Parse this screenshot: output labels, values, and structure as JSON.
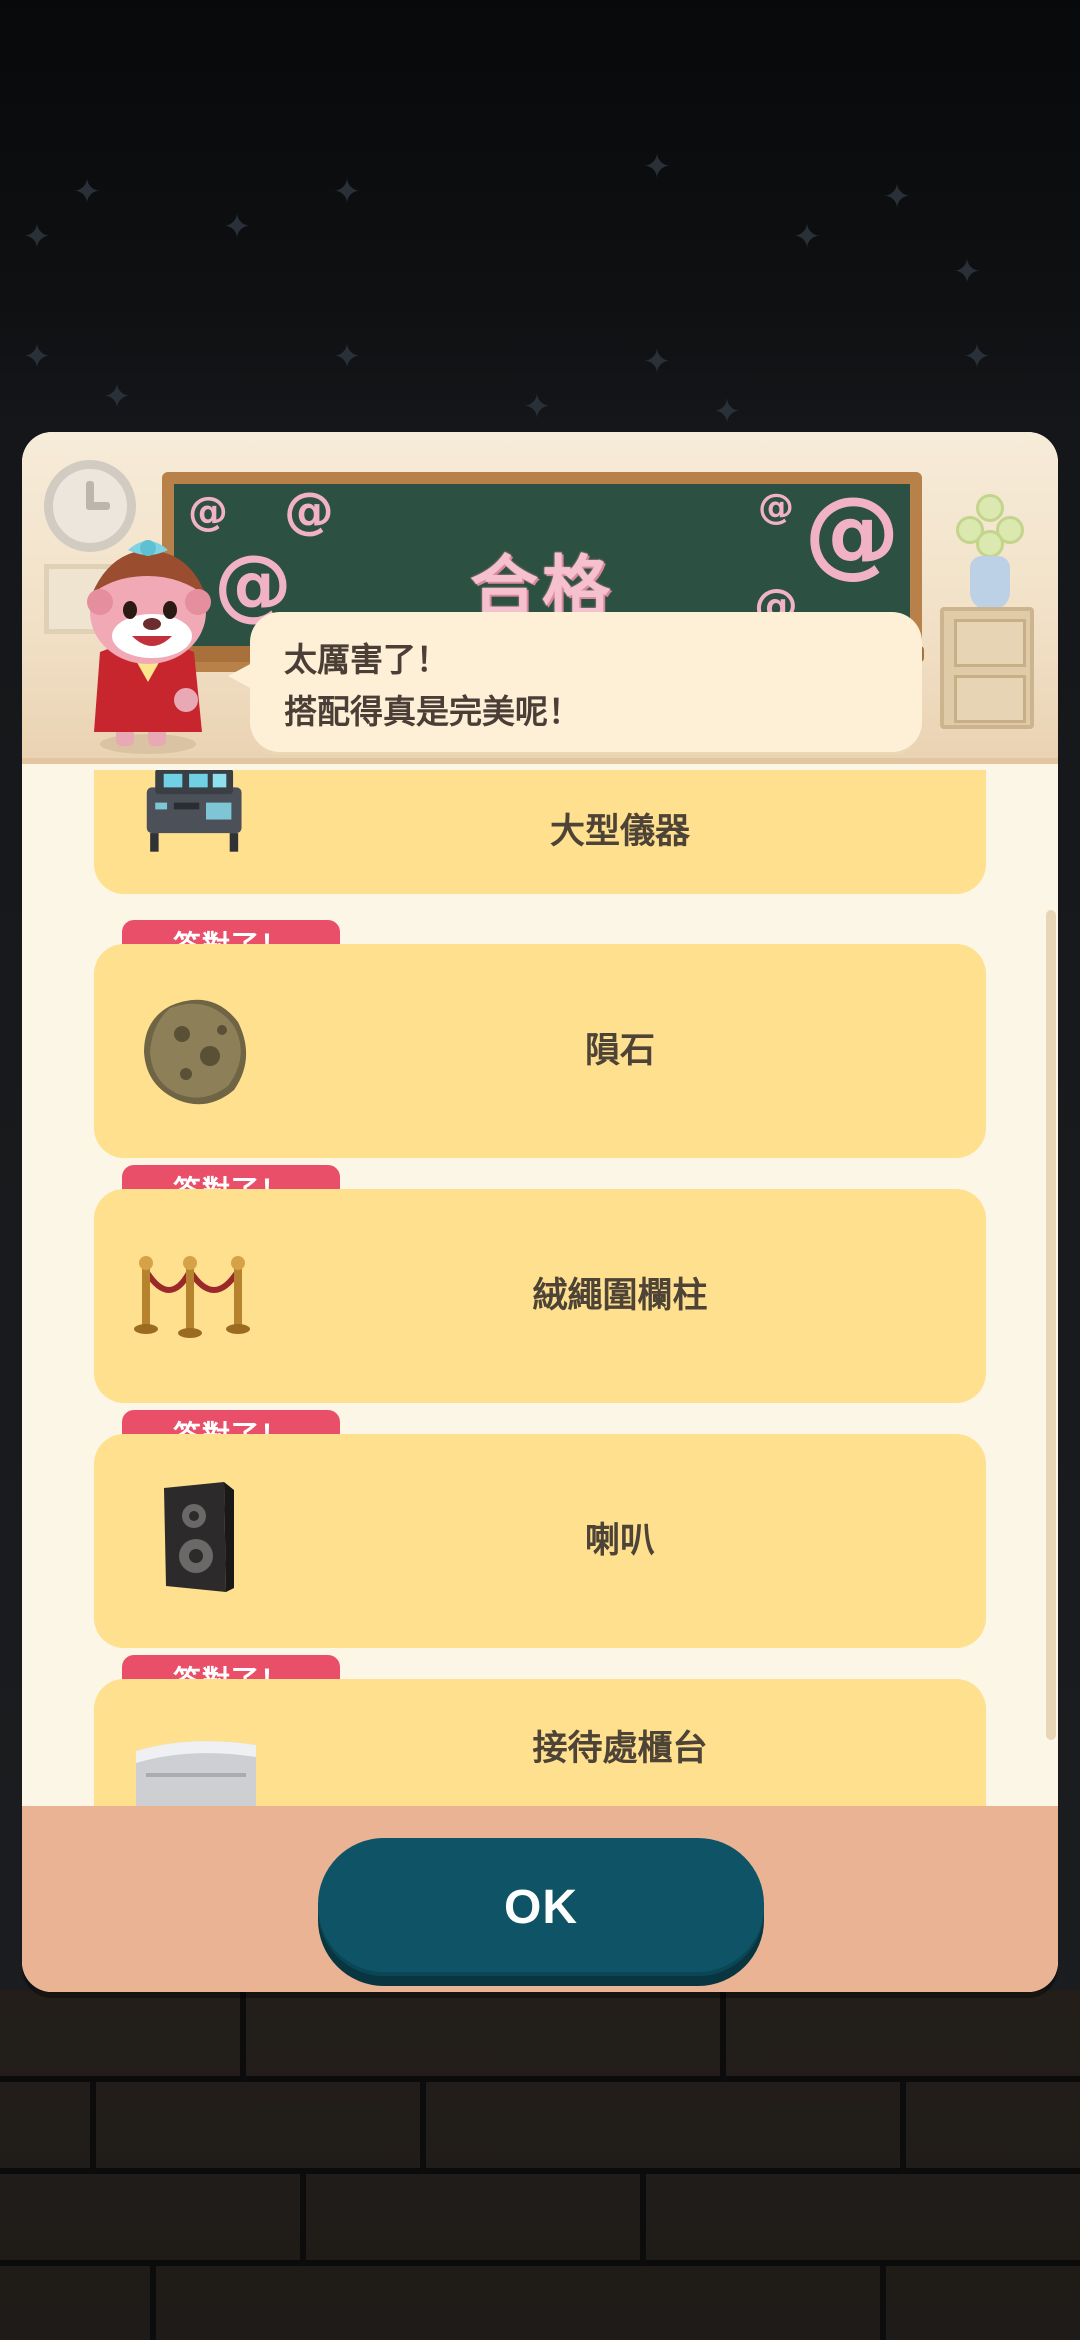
{
  "dialog": {
    "board_title": "合格",
    "speech_line1": "太厲害了！",
    "speech_line2": "搭配得真是完美呢！"
  },
  "items": [
    {
      "name": "大型儀器",
      "icon": "control-panel-icon",
      "badge": ""
    },
    {
      "name": "隕石",
      "icon": "meteorite-icon",
      "badge": "答對了！"
    },
    {
      "name": "絨繩圍欄柱",
      "icon": "rope-barrier-icon",
      "badge": "答對了！"
    },
    {
      "name": "喇叭",
      "icon": "speaker-icon",
      "badge": "答對了！"
    },
    {
      "name": "接待處櫃台",
      "icon": "reception-counter-icon",
      "badge": "答對了！"
    }
  ],
  "footer": {
    "ok_label": "OK"
  },
  "colors": {
    "badge": "#e94f69",
    "item_card": "#ffe08e",
    "ok_button": "#0e5466",
    "footer": "#eab494",
    "chalkboard": "#2c5041"
  }
}
